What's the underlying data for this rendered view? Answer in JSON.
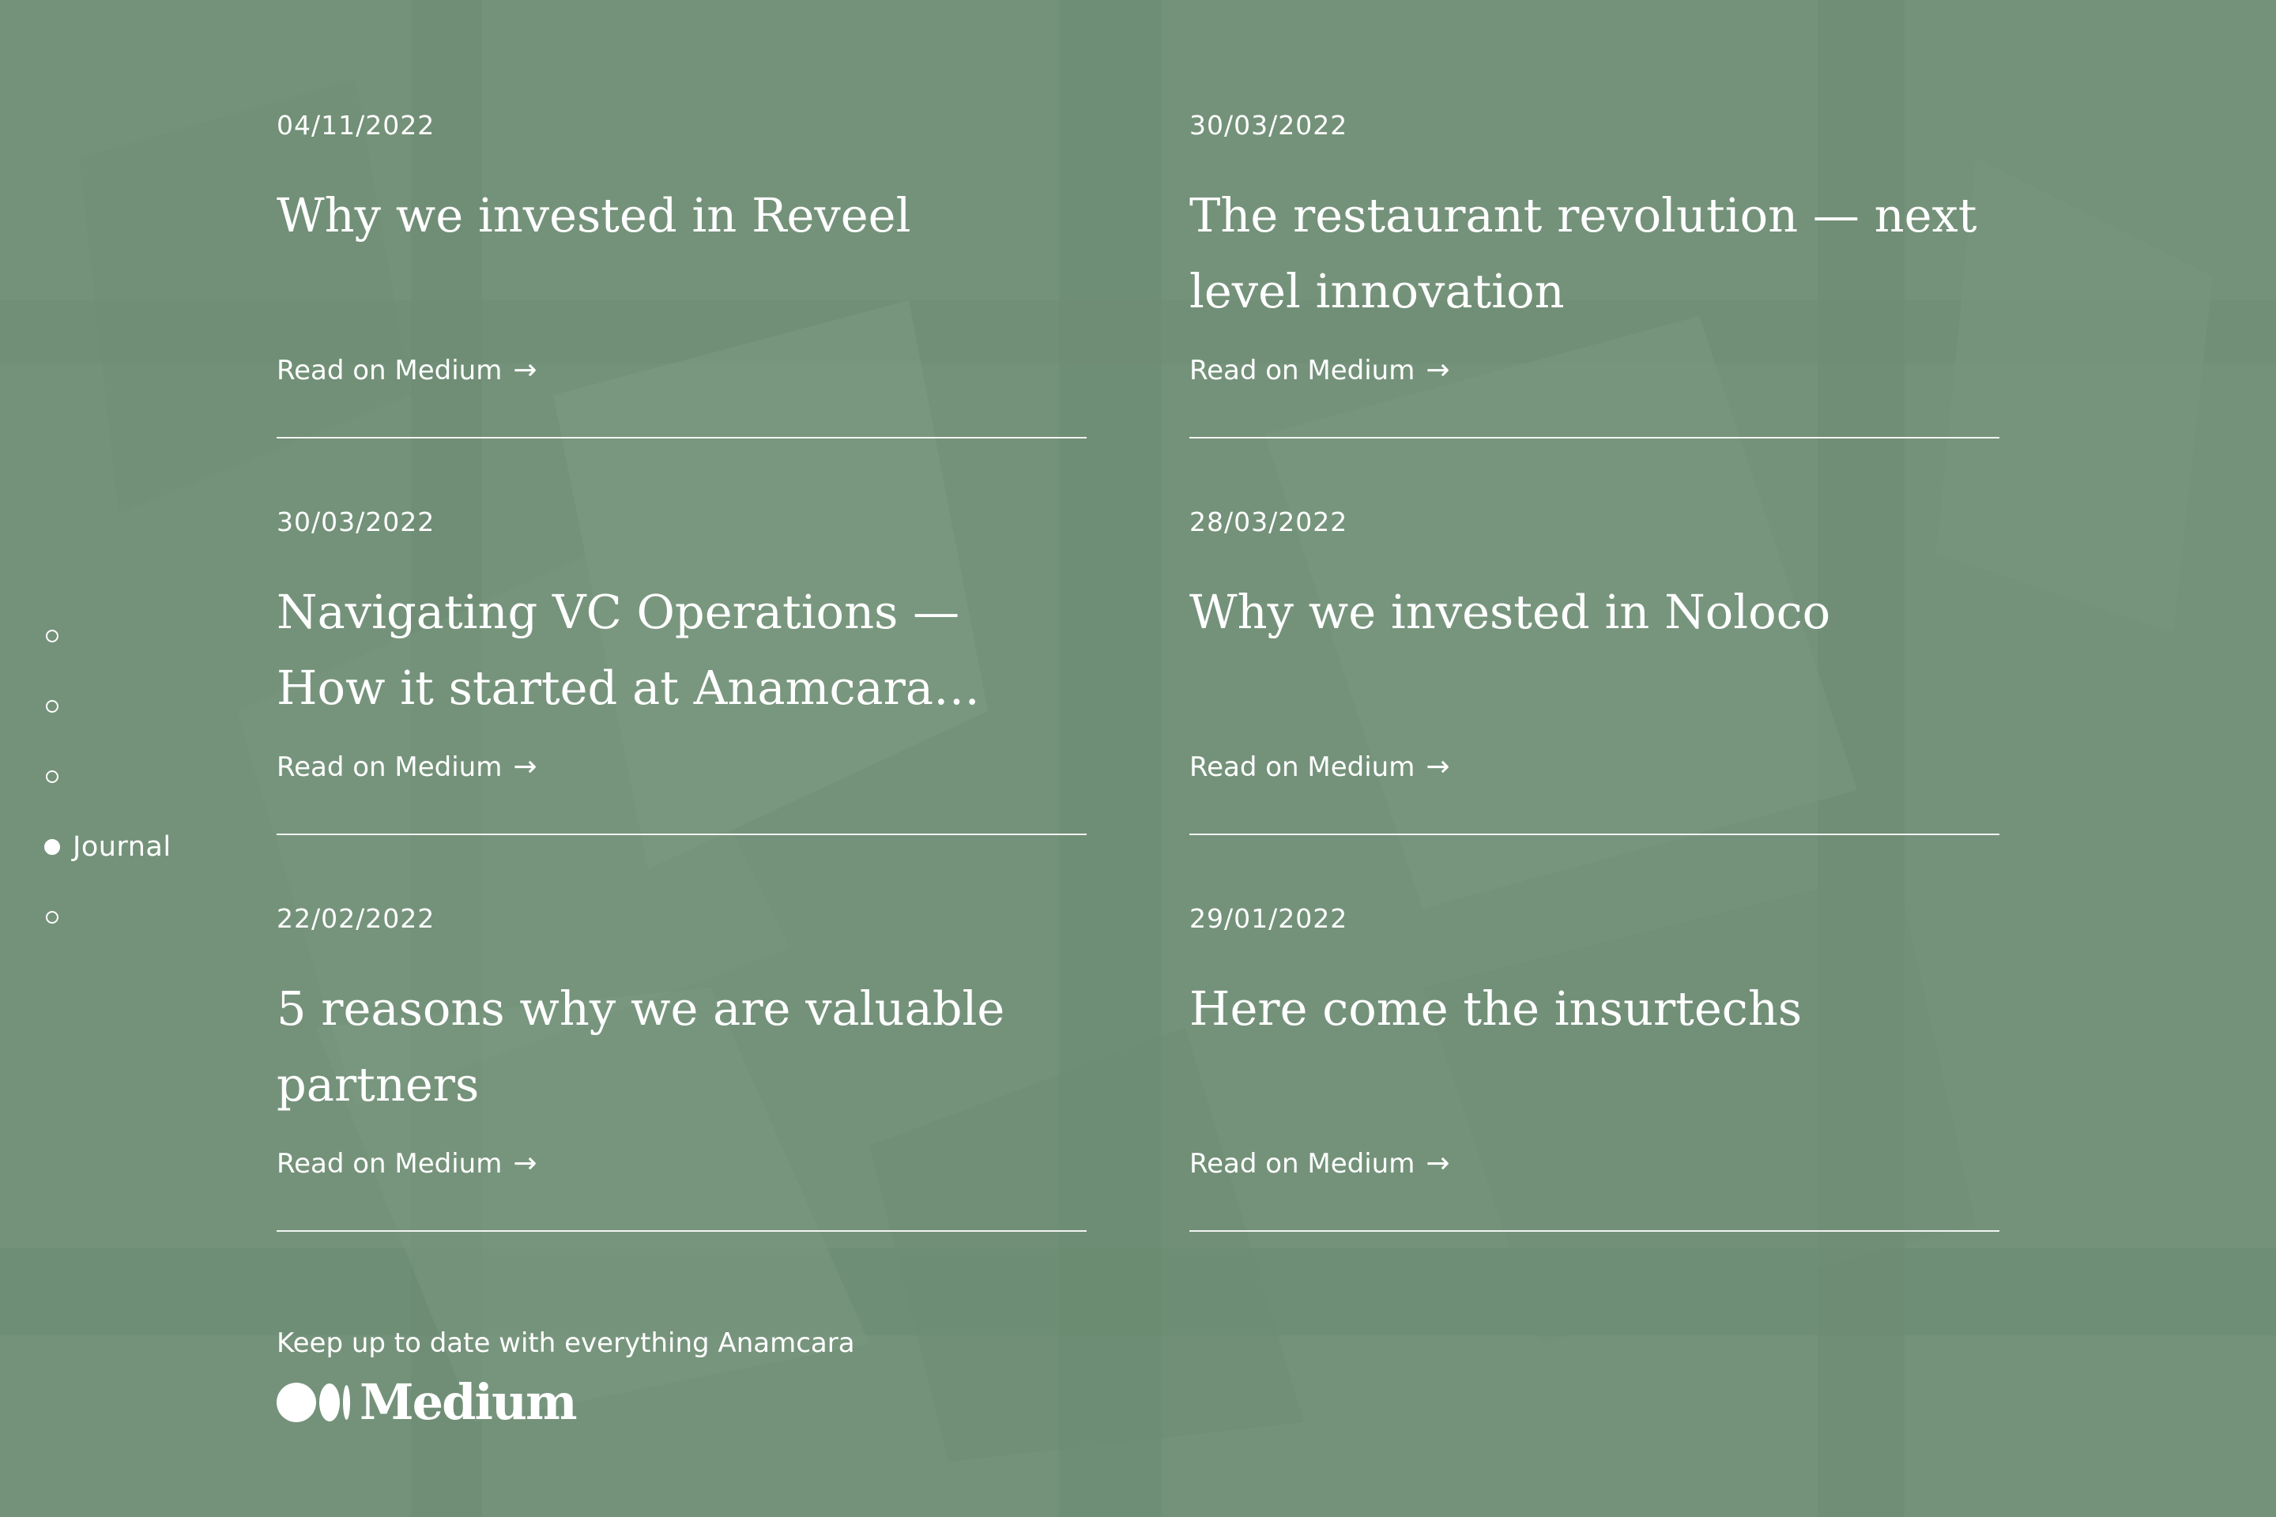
{
  "colors": {
    "background": "#74927a",
    "text": "#ffffff"
  },
  "nav": {
    "items": [
      {
        "label": "",
        "active": false
      },
      {
        "label": "",
        "active": false
      },
      {
        "label": "",
        "active": false
      },
      {
        "label": "Journal",
        "active": true
      },
      {
        "label": "",
        "active": false
      }
    ]
  },
  "articles": [
    {
      "date": "04/11/2022",
      "title": "Why we invested in Reveel",
      "link": "Read on Medium",
      "arrow": "→"
    },
    {
      "date": "30/03/2022",
      "title": "The restaurant revolution — next level innovation",
      "link": "Read on Medium",
      "arrow": "→"
    },
    {
      "date": "30/03/2022",
      "title": "Navigating VC Operations — How it started at Anamcara…",
      "link": "Read on Medium",
      "arrow": "→"
    },
    {
      "date": "28/03/2022",
      "title": "Why we invested in Noloco",
      "link": "Read on Medium",
      "arrow": "→"
    },
    {
      "date": "22/02/2022",
      "title": "5 reasons why we are valuable partners",
      "link": "Read on Medium",
      "arrow": "→"
    },
    {
      "date": "29/01/2022",
      "title": "Here come the insurtechs",
      "link": "Read on Medium",
      "arrow": "→"
    }
  ],
  "footer": {
    "text": "Keep up to date with everything Anamcara",
    "brand": "Medium",
    "brand_icon": "medium-logo-icon"
  }
}
